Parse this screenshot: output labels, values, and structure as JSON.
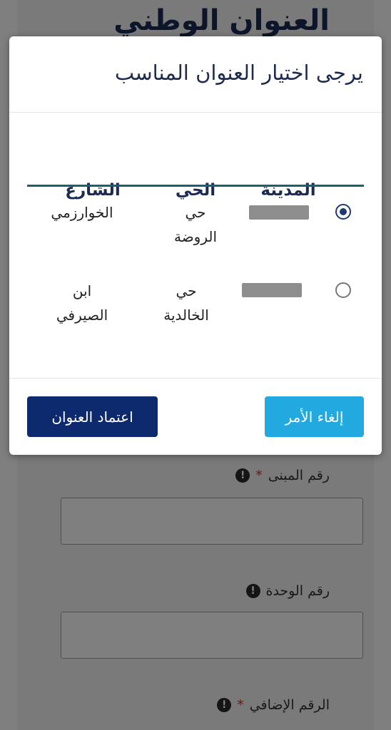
{
  "page": {
    "title": "العنوان الوطني",
    "fields": [
      {
        "label": "رقم المبنى",
        "required": true
      },
      {
        "label": "رقم الوحدة",
        "required": false
      },
      {
        "label": "الرقم الإضافي",
        "required": true
      }
    ],
    "required_mark": "*",
    "info_icon_glyph": "!"
  },
  "modal": {
    "title": "يرجى اختيار العنوان المناسب",
    "columns": {
      "city": "المدينة",
      "district": "الحي",
      "street": "الشارع"
    },
    "rows": [
      {
        "selected": true,
        "city": "",
        "district_line1": "حي",
        "district_line2": "الروضة",
        "street_line1": "الخوارزمي",
        "street_line2": ""
      },
      {
        "selected": false,
        "city": "",
        "district_line1": "حي",
        "district_line2": "الخالدية",
        "street_line1": "ابن",
        "street_line2": "الصيرفي"
      }
    ],
    "buttons": {
      "cancel": "إلغاء الأمر",
      "confirm": "اعتماد العنوان"
    }
  },
  "colors": {
    "primary": "#0d2a6e",
    "accent": "#22a9e0",
    "table_rule": "#1e5e73"
  }
}
